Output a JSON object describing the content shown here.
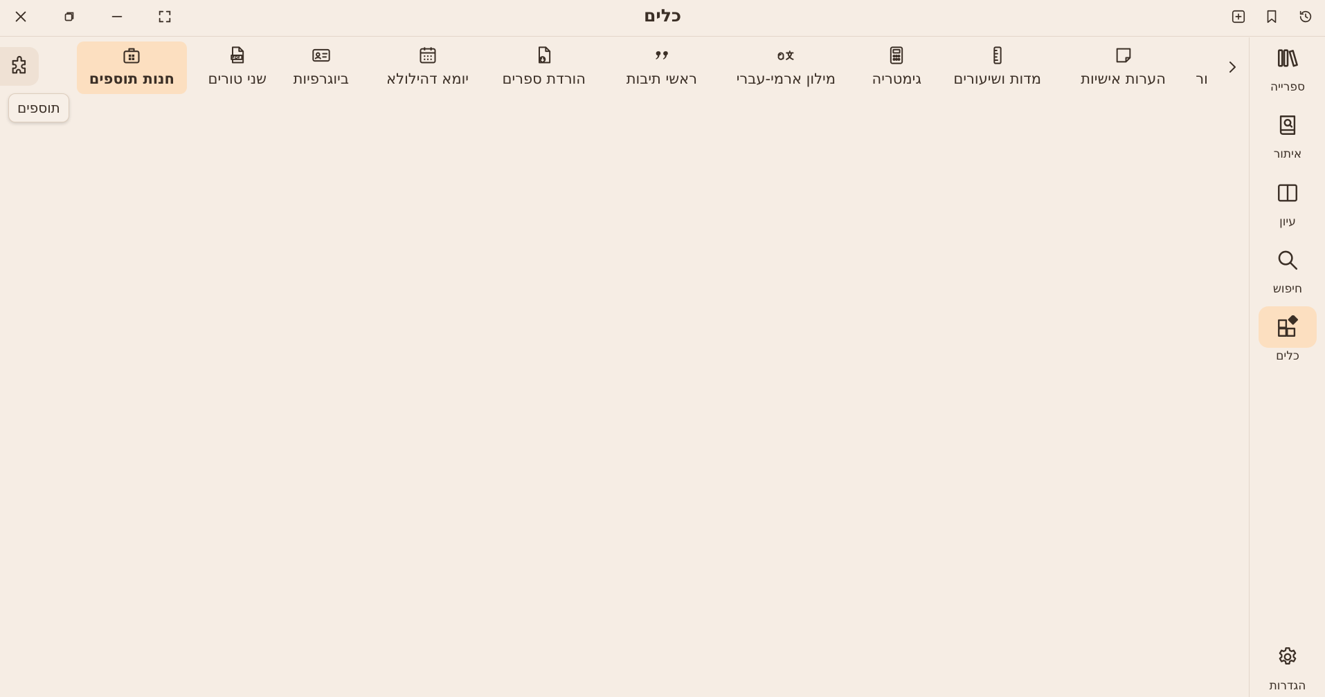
{
  "window": {
    "title": "כלים"
  },
  "rail": {
    "items": [
      {
        "label": "ספרייה",
        "icon": "library-icon"
      },
      {
        "label": "איתור",
        "icon": "book-search-icon"
      },
      {
        "label": "עיון",
        "icon": "open-book-icon"
      },
      {
        "label": "חיפוש",
        "icon": "search-icon"
      },
      {
        "label": "כלים",
        "icon": "tools-grid-icon"
      }
    ],
    "settings": {
      "label": "הגדרות",
      "icon": "gear-icon"
    }
  },
  "tools": {
    "items": [
      {
        "label": "ור",
        "icon": ""
      },
      {
        "label": "הערות אישיות",
        "icon": "sticky-note-icon"
      },
      {
        "label": "מדות ושיעורים",
        "icon": "ruler-icon"
      },
      {
        "label": "גימטריה",
        "icon": "calculator-icon"
      },
      {
        "label": "מילון ארמי-עברי",
        "icon": "translate-icon"
      },
      {
        "label": "ראשי תיבות",
        "icon": "quote-icon"
      },
      {
        "label": "הורדת ספרים",
        "icon": "file-download-icon"
      },
      {
        "label": "יומא דהילולא",
        "icon": "calendar-icon"
      },
      {
        "label": "ביוגרפיות",
        "icon": "id-card-icon"
      },
      {
        "label": "שני טורים",
        "icon": "pdf-file-icon"
      },
      {
        "label": "חנות תוספים",
        "icon": "store-icon"
      }
    ],
    "active": "חנות תוספים"
  },
  "tooltip": {
    "text": "תוספים"
  },
  "colors": {
    "background": "#f6ede4",
    "accent": "#fcdfc0",
    "text": "#3b2f26"
  }
}
